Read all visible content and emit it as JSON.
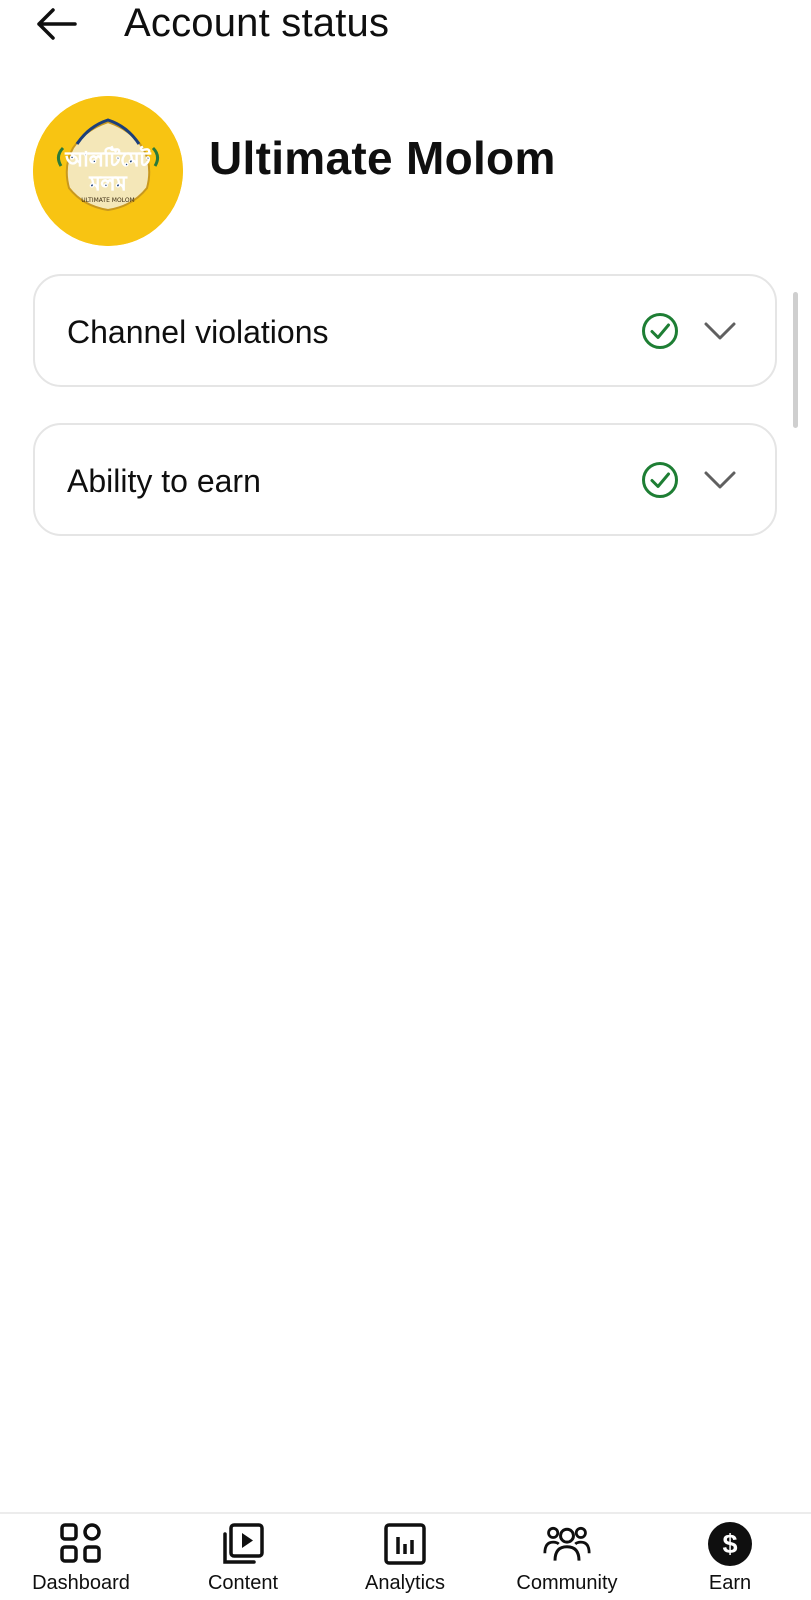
{
  "header": {
    "title": "Account status",
    "back_icon": "arrow-left-icon"
  },
  "channel": {
    "name": "Ultimate Molom",
    "avatar_color": "#f8c412",
    "logo_text_bn_top": "আলটিমেট",
    "logo_text_bn_bottom": "মলম",
    "logo_text_en": "ULTIMATE MOLOM"
  },
  "status_items": [
    {
      "label": "Channel violations",
      "status_icon": "check-circle-icon",
      "expand_icon": "chevron-down-icon"
    },
    {
      "label": "Ability to earn",
      "status_icon": "check-circle-icon",
      "expand_icon": "chevron-down-icon"
    }
  ],
  "colors": {
    "ok_green": "#1e7e34",
    "chevron_gray": "#606060",
    "card_border": "#e5e5e5"
  },
  "bottom_nav": {
    "items": [
      {
        "label": "Dashboard",
        "icon": "dashboard-grid-icon"
      },
      {
        "label": "Content",
        "icon": "content-play-icon"
      },
      {
        "label": "Analytics",
        "icon": "analytics-chart-icon"
      },
      {
        "label": "Community",
        "icon": "community-people-icon"
      },
      {
        "label": "Earn",
        "icon": "earn-dollar-icon"
      }
    ]
  }
}
